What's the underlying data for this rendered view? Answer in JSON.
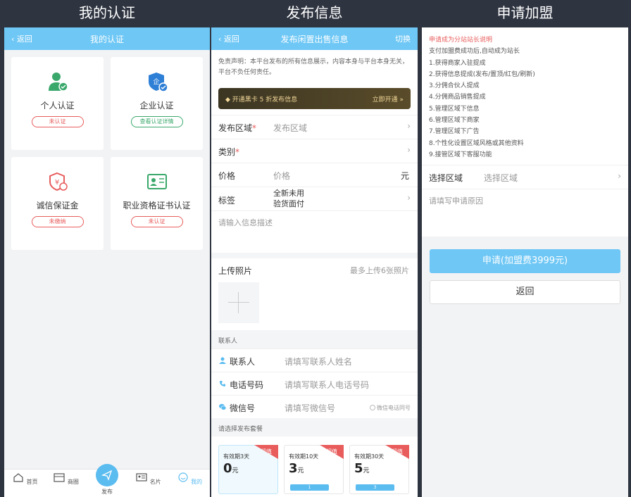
{
  "headers": [
    "我的认证",
    "发布信息",
    "申请加盟"
  ],
  "p1": {
    "back": "返回",
    "title": "我的认证",
    "cards": [
      {
        "label": "个人认证",
        "btn": "未认证",
        "icon": "person-check-icon"
      },
      {
        "label": "企业认证",
        "btn": "查看认证详情",
        "icon": "shield-enterprise-icon"
      },
      {
        "label": "诚信保证金",
        "btn": "未缴纳",
        "icon": "deposit-icon"
      },
      {
        "label": "职业资格证书认证",
        "btn": "未认证",
        "icon": "certificate-icon"
      }
    ],
    "tabs": [
      "首页",
      "商圈",
      "发布",
      "名片",
      "我的"
    ]
  },
  "p2": {
    "back": "返回",
    "title": "发布闲置出售信息",
    "right": "切换",
    "disclaimer": "免责声明：本平台发布的所有信息展示，内容本身与平台本身无关，平台不负任何责任。",
    "vip_left": "开通黑卡 5 折发布信息",
    "vip_right": "立即开通 »",
    "region_label": "发布区域",
    "region_placeholder": "发布区域",
    "category_label": "类别",
    "price_label": "价格",
    "price_placeholder": "价格",
    "price_unit": "元",
    "tag_label": "标签",
    "tag_1": "全新未用",
    "tag_2": "验货面付",
    "desc_placeholder": "请输入信息描述",
    "photo_label": "上传照片",
    "photo_hint": "最多上传6张照片",
    "contact_section": "联系人",
    "contact_label": "联系人",
    "contact_placeholder": "请填写联系人姓名",
    "phone_label": "电话号码",
    "phone_placeholder": "请填写联系人电话号码",
    "wechat_label": "微信号",
    "wechat_placeholder": "请填写微信号",
    "wechat_same": "微信电话同号",
    "package_section": "请选择发布套餐",
    "packages": [
      {
        "title": "有效期3天",
        "price": "0",
        "unit": "元",
        "ribbon": "超值",
        "bar": ""
      },
      {
        "title": "有效期10天",
        "price": "3",
        "unit": "元",
        "ribbon": "超值",
        "bar": "1"
      },
      {
        "title": "有效期30天",
        "price": "5",
        "unit": "元",
        "ribbon": "超值",
        "bar": "3"
      }
    ]
  },
  "p3": {
    "heading": "申请成为分站站长说明",
    "lines": [
      "支付加盟费成功后,自动成为站长",
      "1.获得商家入驻提成",
      "2.获得信息提成(发布/置顶/红包/刷新)",
      "3.分佣合伙人提成",
      "4.分佣商品销售提成",
      "5.管理区域下信息",
      "6.管理区域下商家",
      "7.管理区域下广告",
      "8.个性化设置区域风格或其他资料",
      "9.接管区域下客服功能"
    ],
    "area_label": "选择区域",
    "area_placeholder": "选择区域",
    "reason_placeholder": "请填写申请原因",
    "apply_btn": "申请(加盟费3999元)",
    "back_btn": "返回"
  }
}
